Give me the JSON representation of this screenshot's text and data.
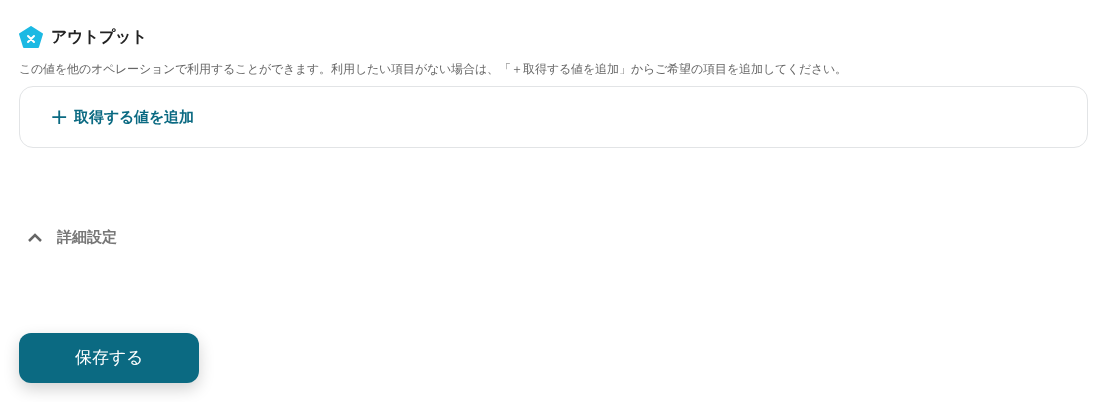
{
  "output_section": {
    "title": "アウトプット",
    "description": "この値を他のオペレーションで利用することができます。利用したい項目がない場合は、「＋取得する値を追加」からご希望の項目を追加してください。",
    "add_button": {
      "icon": "+",
      "label": "取得する値を追加"
    }
  },
  "advanced_settings": {
    "label": "詳細設定",
    "expanded": true
  },
  "save_button": {
    "label": "保存する"
  }
}
